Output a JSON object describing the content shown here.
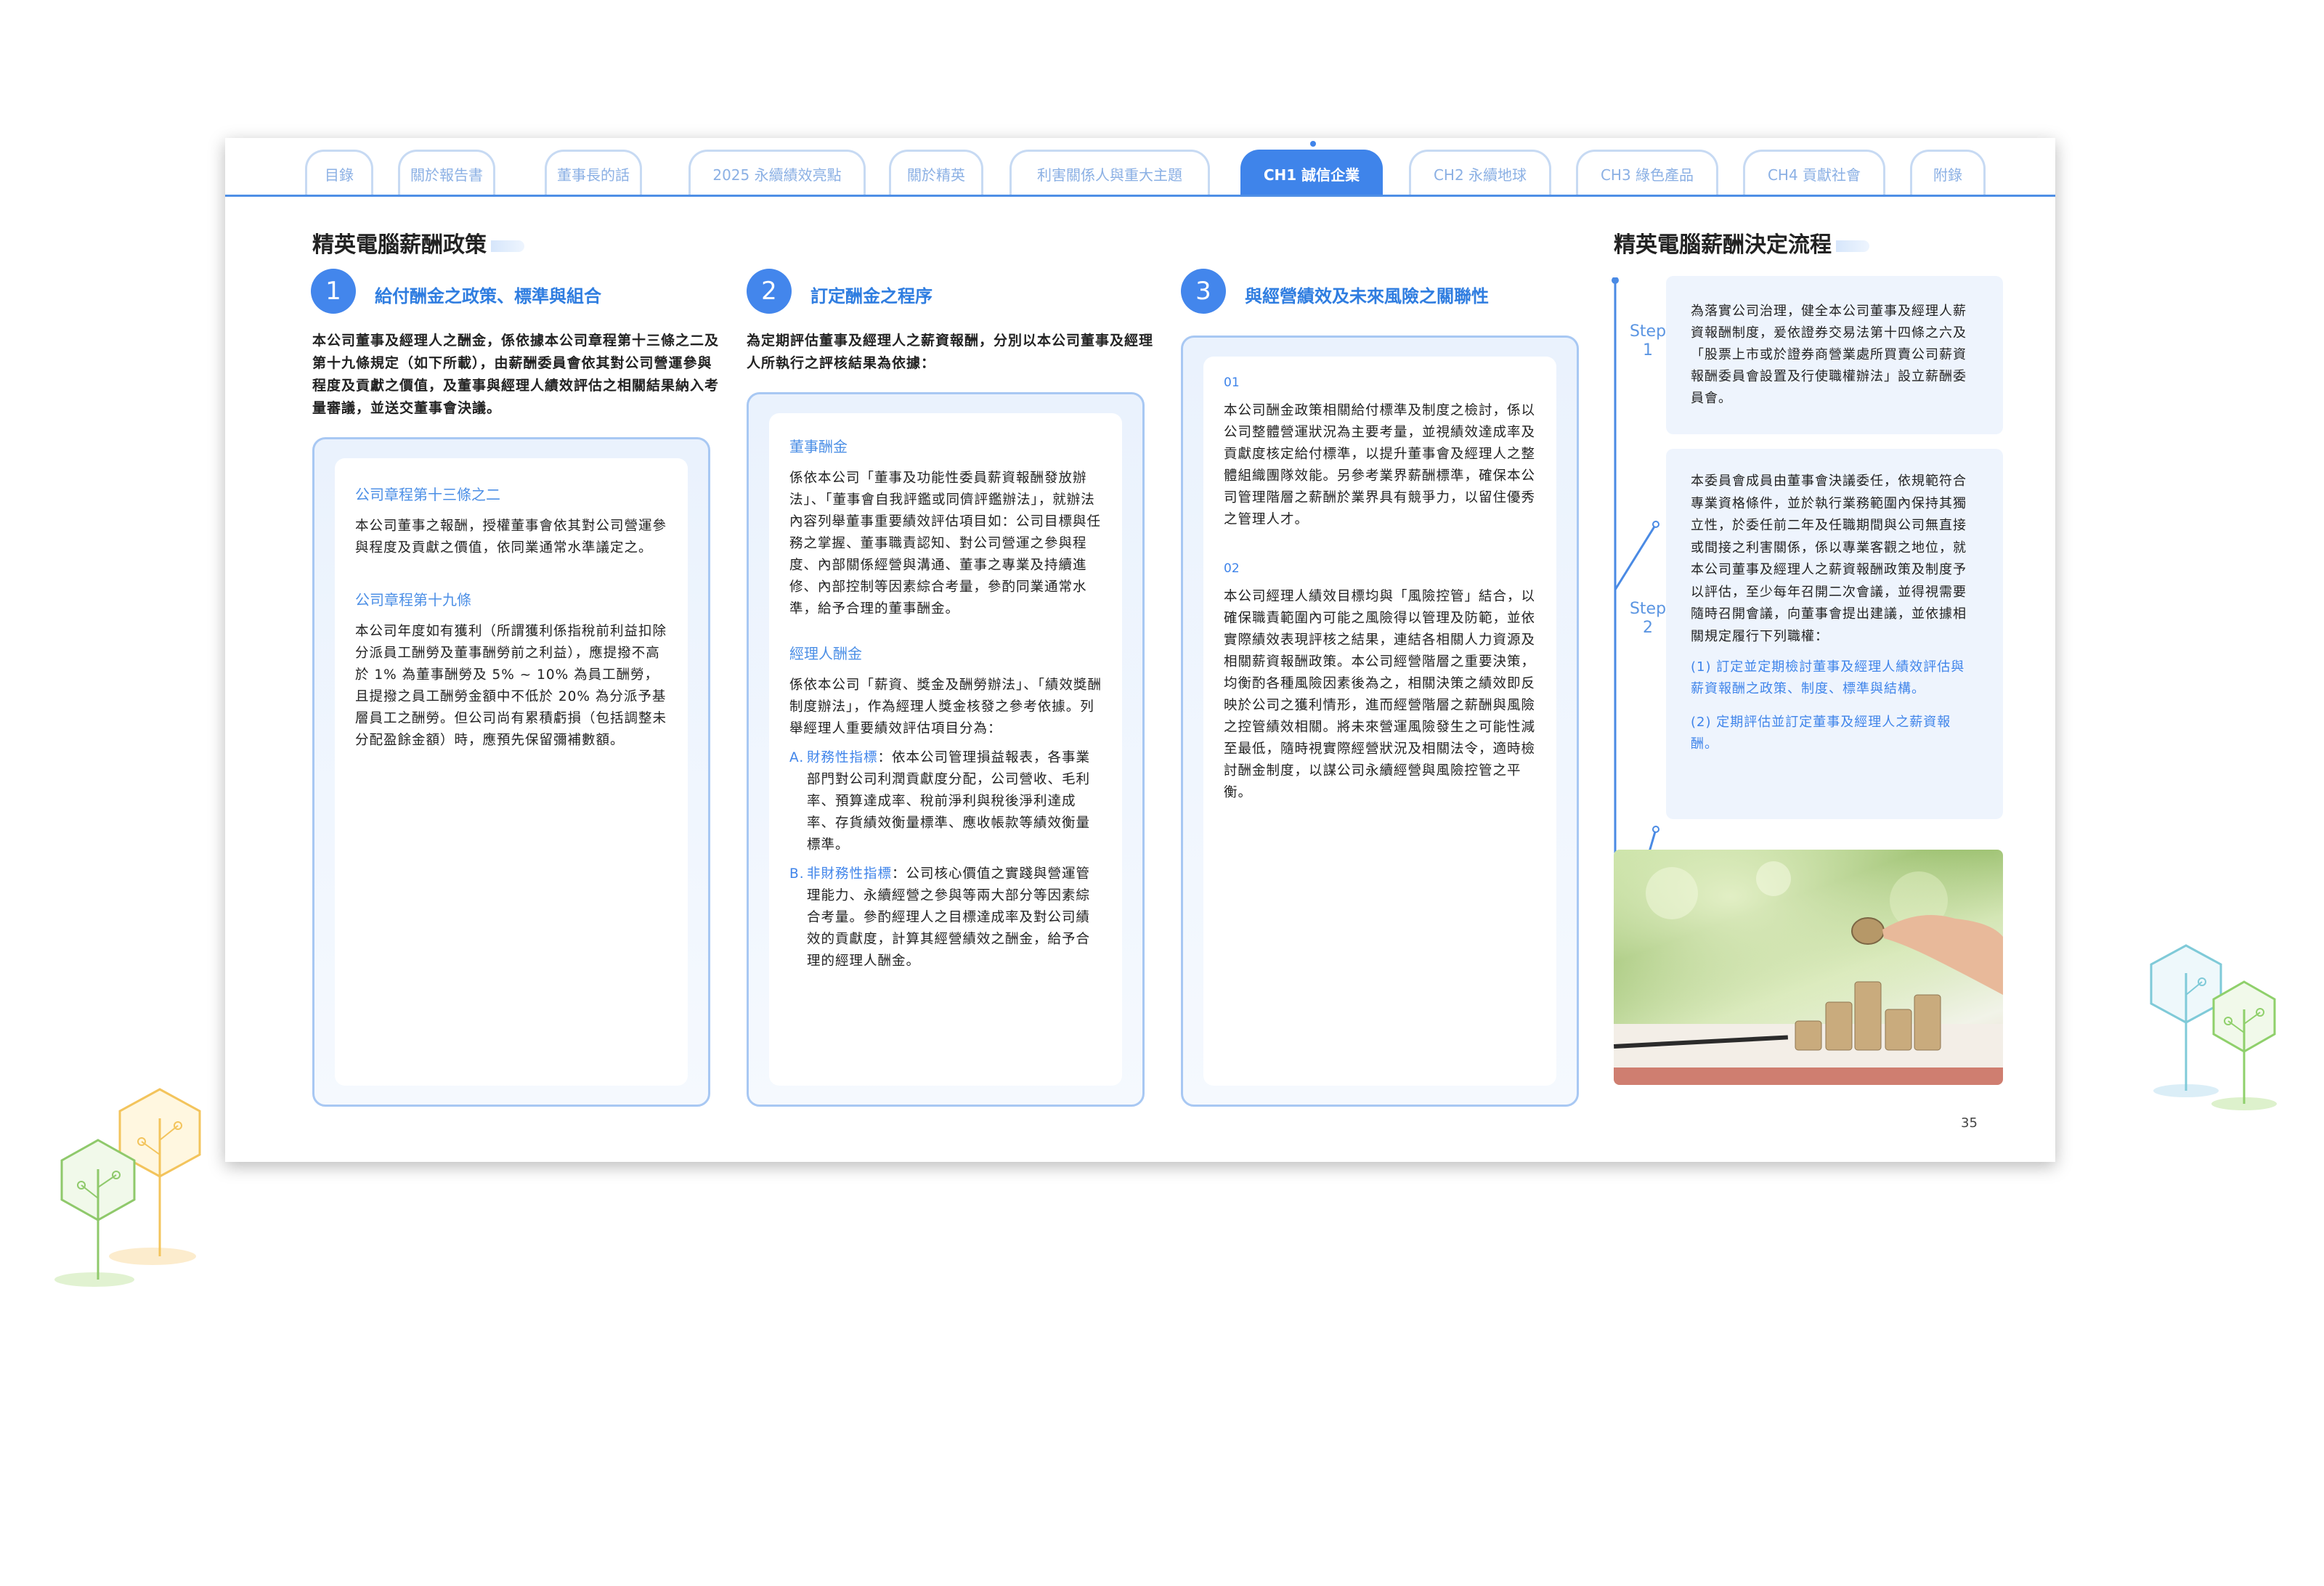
{
  "nav": {
    "tabs": [
      {
        "label": "目錄"
      },
      {
        "label": "關於報告書"
      },
      {
        "label": "董事長的話"
      },
      {
        "label": "2025 永續績效亮點"
      },
      {
        "label": "關於精英"
      },
      {
        "label": "利害關係人與重大主題"
      },
      {
        "label": "CH1 誠信企業",
        "active": true
      },
      {
        "label": "CH2 永續地球"
      },
      {
        "label": "CH3 綠色產品"
      },
      {
        "label": "CH4 貢獻社會"
      },
      {
        "label": "附錄"
      }
    ]
  },
  "left": {
    "title": "精英電腦薪酬政策",
    "col1": {
      "number": "1",
      "heading": "給付酬金之政策、標準與組合",
      "intro": "本公司董事及經理人之酬金，係依據本公司章程第十三條之二及第十九條規定（如下所載），由薪酬委員會依其對公司營運參與程度及貢獻之價值，及董事與經理人績效評估之相關結果納入考量審議，並送交董事會決議。",
      "block1_title": "公司章程第十三條之二",
      "block1_text": "本公司董事之報酬，授權董事會依其對公司營運參與程度及貢獻之價值，依同業通常水準議定之。",
      "block2_title": "公司章程第十九條",
      "block2_text": "本公司年度如有獲利（所謂獲利係指稅前利益扣除分派員工酬勞及董事酬勞前之利益），應提撥不高於 1% 為董事酬勞及 5% ~ 10% 為員工酬勞，且提撥之員工酬勞金額中不低於 20% 為分派予基層員工之酬勞。但公司尚有累積虧損（包括調整未分配盈餘金額）時，應預先保留彌補數額。"
    },
    "col2": {
      "number": "2",
      "heading": "訂定酬金之程序",
      "intro": "為定期評估董事及經理人之薪資報酬，分別以本公司董事及經理人所執行之評核結果為依據：",
      "block1_title": "董事酬金",
      "block1_text": "係依本公司「董事及功能性委員薪資報酬發放辦法」、「董事會自我評鑑或同儕評鑑辦法」，就辦法內容列舉董事重要績效評估項目如：公司目標與任務之掌握、董事職責認知、對公司營運之參與程度、內部關係經營與溝通、董事之專業及持續進修、內部控制等因素綜合考量，參酌同業通常水準，給予合理的董事酬金。",
      "block2_title": "經理人酬金",
      "block2_text": "係依本公司「薪資、獎金及酬勞辦法」、「績效獎酬制度辦法」，作為經理人獎金核發之參考依據。列舉經理人重要績效評估項目分為：",
      "itemA_mark": "A.",
      "itemA_label": "財務性指標",
      "itemA_text": "：依本公司管理損益報表，各事業部門對公司利潤貢獻度分配，公司營收、毛利率、預算達成率、稅前淨利與稅後淨利達成率、存貨績效衡量標準、應收帳款等績效衡量標準。",
      "itemB_mark": "B.",
      "itemB_label": "非財務性指標",
      "itemB_text": "：公司核心價值之實踐與營運管理能力、永續經營之參與等兩大部分等因素綜合考量。參酌經理人之目標達成率及對公司績效的貢獻度，計算其經營績效之酬金，給予合理的經理人酬金。"
    },
    "col3": {
      "number": "3",
      "heading": "與經營績效及未來風險之關聯性",
      "block1_num": "01",
      "block1_text": "本公司酬金政策相關給付標準及制度之檢討，係以公司整體營運狀況為主要考量，並視績效達成率及貢獻度核定給付標準，以提升董事會及經理人之整體組織團隊效能。另參考業界薪酬標準，確保本公司管理階層之薪酬於業界具有競爭力，以留住優秀之管理人才。",
      "block2_num": "02",
      "block2_text": "本公司經理人績效目標均與「風險控管」結合，以確保職責範圍內可能之風險得以管理及防範，並依實際績效表現評核之結果，連結各相關人力資源及相關薪資報酬政策。本公司經營階層之重要決策，均衡酌各種風險因素後為之，相關決策之績效即反映於公司之獲利情形，進而經營階層之薪酬與風險之控管績效相關。將未來營運風險發生之可能性減至最低，隨時視實際經營狀況及相關法令，適時檢討酬金制度，以謀公司永續經營與風險控管之平衡。"
    }
  },
  "right": {
    "title": "精英電腦薪酬決定流程",
    "step1_label": "Step\n1",
    "step1_word": "Step",
    "step1_num": "1",
    "step1_text": "為落實公司治理，健全本公司董事及經理人薪資報酬制度，爰依證券交易法第十四條之六及「股票上市或於證券商營業處所買賣公司薪資報酬委員會設置及行使職權辦法」設立薪酬委員會。",
    "step2_word": "Step",
    "step2_num": "2",
    "step2_text": "本委員會成員由董事會決議委任，依規範符合專業資格條件，並於執行業務範圍內保持其獨立性，於委任前二年及任職期間與公司無直接或間接之利害關係，係以專業客觀之地位，就本公司董事及經理人之薪資報酬政策及制度予以評估，至少每年召開二次會議，並得視需要隨時召開會議，向董事會提出建議，並依據相關規定履行下列職權：",
    "step2_item1": "(1) 訂定並定期檢討董事及經理人績效評估與薪資報酬之政策、制度、標準與結構。",
    "step2_item2": "(2) 定期評估並訂定董事及經理人之薪資報酬。"
  },
  "page_number": "35",
  "colors": {
    "accent": "#3f84ea",
    "light_blue": "#a8c8f3",
    "panel_bg": "#eef4fd"
  }
}
